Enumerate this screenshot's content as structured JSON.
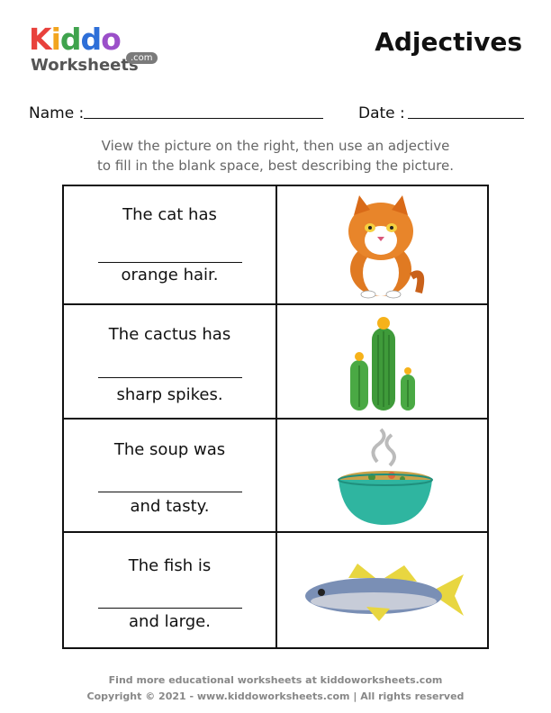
{
  "logo": {
    "brand_letters": [
      "K",
      "i",
      "d",
      "d",
      "o"
    ],
    "brand_colors": [
      "#e8413c",
      "#f2a51e",
      "#3fa34d",
      "#2e6fd8",
      "#9b4fc9"
    ],
    "sub_label": "Worksheets",
    "badge": ".com"
  },
  "title": "Adjectives",
  "fields": {
    "name_label": "Name :",
    "date_label": "Date :"
  },
  "instructions": {
    "line1": "View the picture on the right, then use an adjective",
    "line2": "to fill in the blank space, best describing the picture."
  },
  "rows": [
    {
      "prompt": "The cat has",
      "ending": "orange hair.",
      "picture": "cat-icon"
    },
    {
      "prompt": "The cactus has",
      "ending": "sharp spikes.",
      "picture": "cactus-icon"
    },
    {
      "prompt": "The soup was",
      "ending": "and tasty.",
      "picture": "soup-bowl-icon"
    },
    {
      "prompt": "The fish is",
      "ending": "and large.",
      "picture": "fish-icon"
    }
  ],
  "footer": {
    "line1": "Find more educational worksheets at kiddoworksheets.com",
    "line2": "Copyright © 2021 - www.kiddoworksheets.com  |  All rights reserved"
  }
}
